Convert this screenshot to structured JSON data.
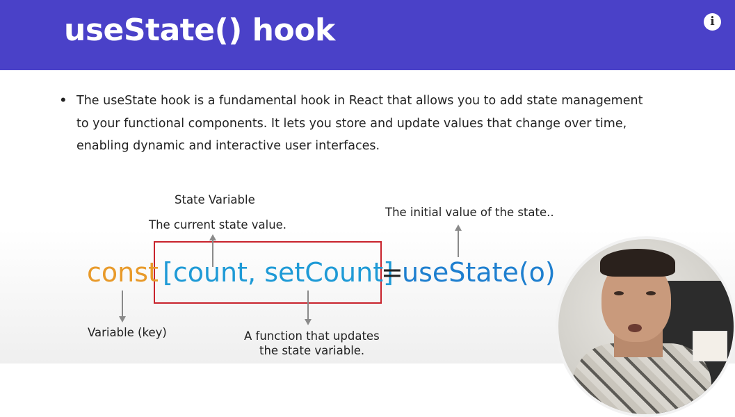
{
  "slide": {
    "title": "useState() hook",
    "bullet": {
      "lines": [
        "The useState hook is a fundamental hook in React that allows you to add state management",
        "to your functional components. It lets you store and update values that change over time,",
        "enabling dynamic and interactive user interfaces."
      ]
    },
    "diagram": {
      "state_variable_label": "State Variable",
      "current_state_label": "The current state value.",
      "initial_value_label": "The initial value of the state..",
      "variable_key_label": "Variable (key)",
      "setter_label_line1": "A function that updates",
      "setter_label_line2": "the state variable.",
      "code": {
        "keyword": "const",
        "destructure": "[count, setCount]",
        "equals": "=",
        "call": "useState(o)"
      }
    }
  },
  "player": {
    "info_icon": "info-icon",
    "info_glyph": "i"
  },
  "colors": {
    "header": "#4a41c8",
    "keyword": "#e89a2a",
    "code_blue": "#1e9ad6",
    "highlight_box": "#c8232c"
  }
}
